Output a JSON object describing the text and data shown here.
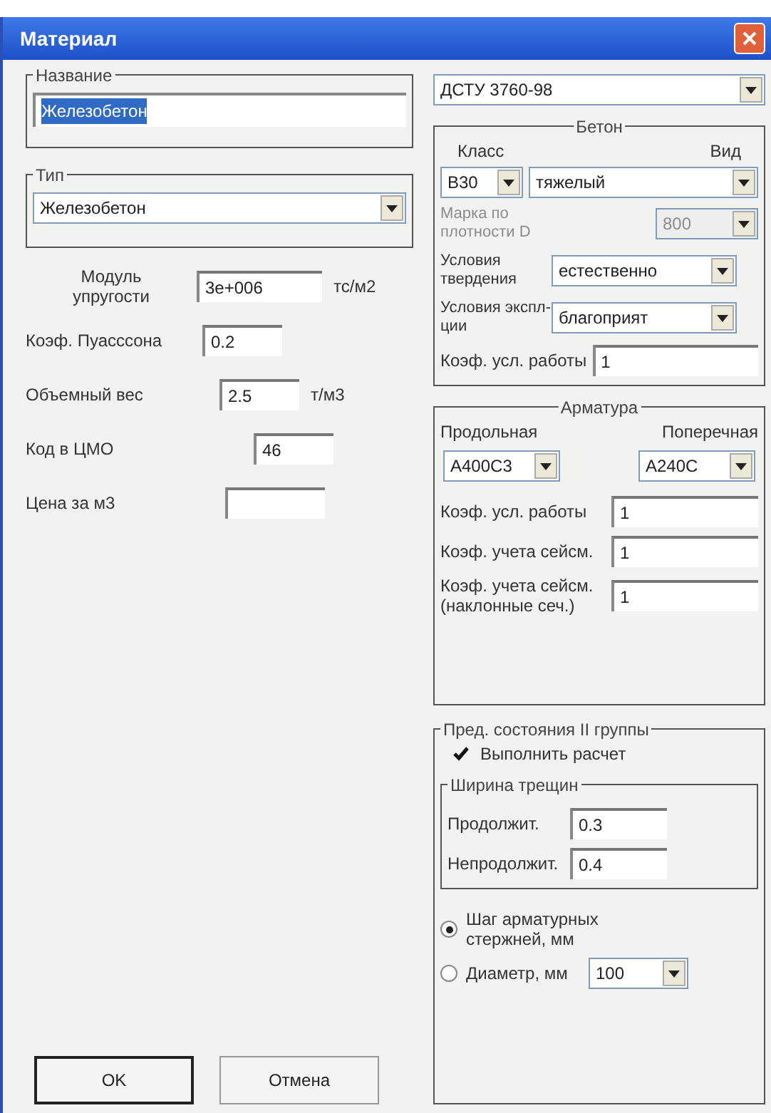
{
  "window": {
    "title": "Материал"
  },
  "name_group": {
    "label": "Название",
    "value": "Железобетон",
    "selected": true
  },
  "type_group": {
    "label": "Тип",
    "value": "Железобетон"
  },
  "properties": [
    {
      "label": "Модуль упругости",
      "value": "3e+006",
      "unit": "тс/м2"
    },
    {
      "label": "Коэф. Пуасссона",
      "value": "0.2"
    },
    {
      "label": "Объемный вес",
      "value": "2.5",
      "unit": "т/м3"
    },
    {
      "label": "Код в ЦМО",
      "value": "46"
    },
    {
      "label": "Цена за м3"
    }
  ],
  "norm": {
    "value": "ДСТУ 3760-98"
  },
  "concrete": {
    "title": "Бетон",
    "class_label": "Класс",
    "class_value": "B30",
    "kind_label": "Вид",
    "kind_value": "тяжелый",
    "density": {
      "label": "Марка по плотности D",
      "value": "800",
      "disabled": true
    },
    "hardening": {
      "label": "Условия твердения",
      "value": "естественно"
    },
    "exploitation": {
      "label": "Условия экспл-ции",
      "value": "благоприят"
    },
    "work_coef": {
      "label": "Коэф. усл. работы",
      "value": "1"
    }
  },
  "rebar": {
    "title": "Арматура",
    "longitudinal": {
      "label": "Продольная",
      "value": "A400C3"
    },
    "transverse": {
      "label": "Поперечная",
      "value": "A240C"
    },
    "coefs": [
      {
        "label": "Коэф. усл. работы",
        "value": "1"
      },
      {
        "label": "Коэф. учета сейсм.",
        "value": "1"
      },
      {
        "label": "Коэф. учета сейсм. (наклонные сеч.)",
        "value": "1"
      }
    ]
  },
  "limit_states": {
    "title": "Пред. состояния II группы",
    "calc": {
      "label": "Выполнить расчет",
      "checked": true
    },
    "crack": {
      "title": "Ширина трещин",
      "fields": [
        {
          "label": "Продолжит.",
          "value": "0.3"
        },
        {
          "label": "Непродолжит.",
          "value": "0.4"
        }
      ]
    },
    "options": [
      {
        "label": "Шаг арматурных стержней, мм",
        "selected": true
      },
      {
        "label": "Диаметр, мм",
        "selected": false
      }
    ],
    "select_value": "100"
  },
  "buttons": [
    {
      "label": "OK",
      "default": true
    },
    {
      "label": "Отмена",
      "default": false
    }
  ]
}
